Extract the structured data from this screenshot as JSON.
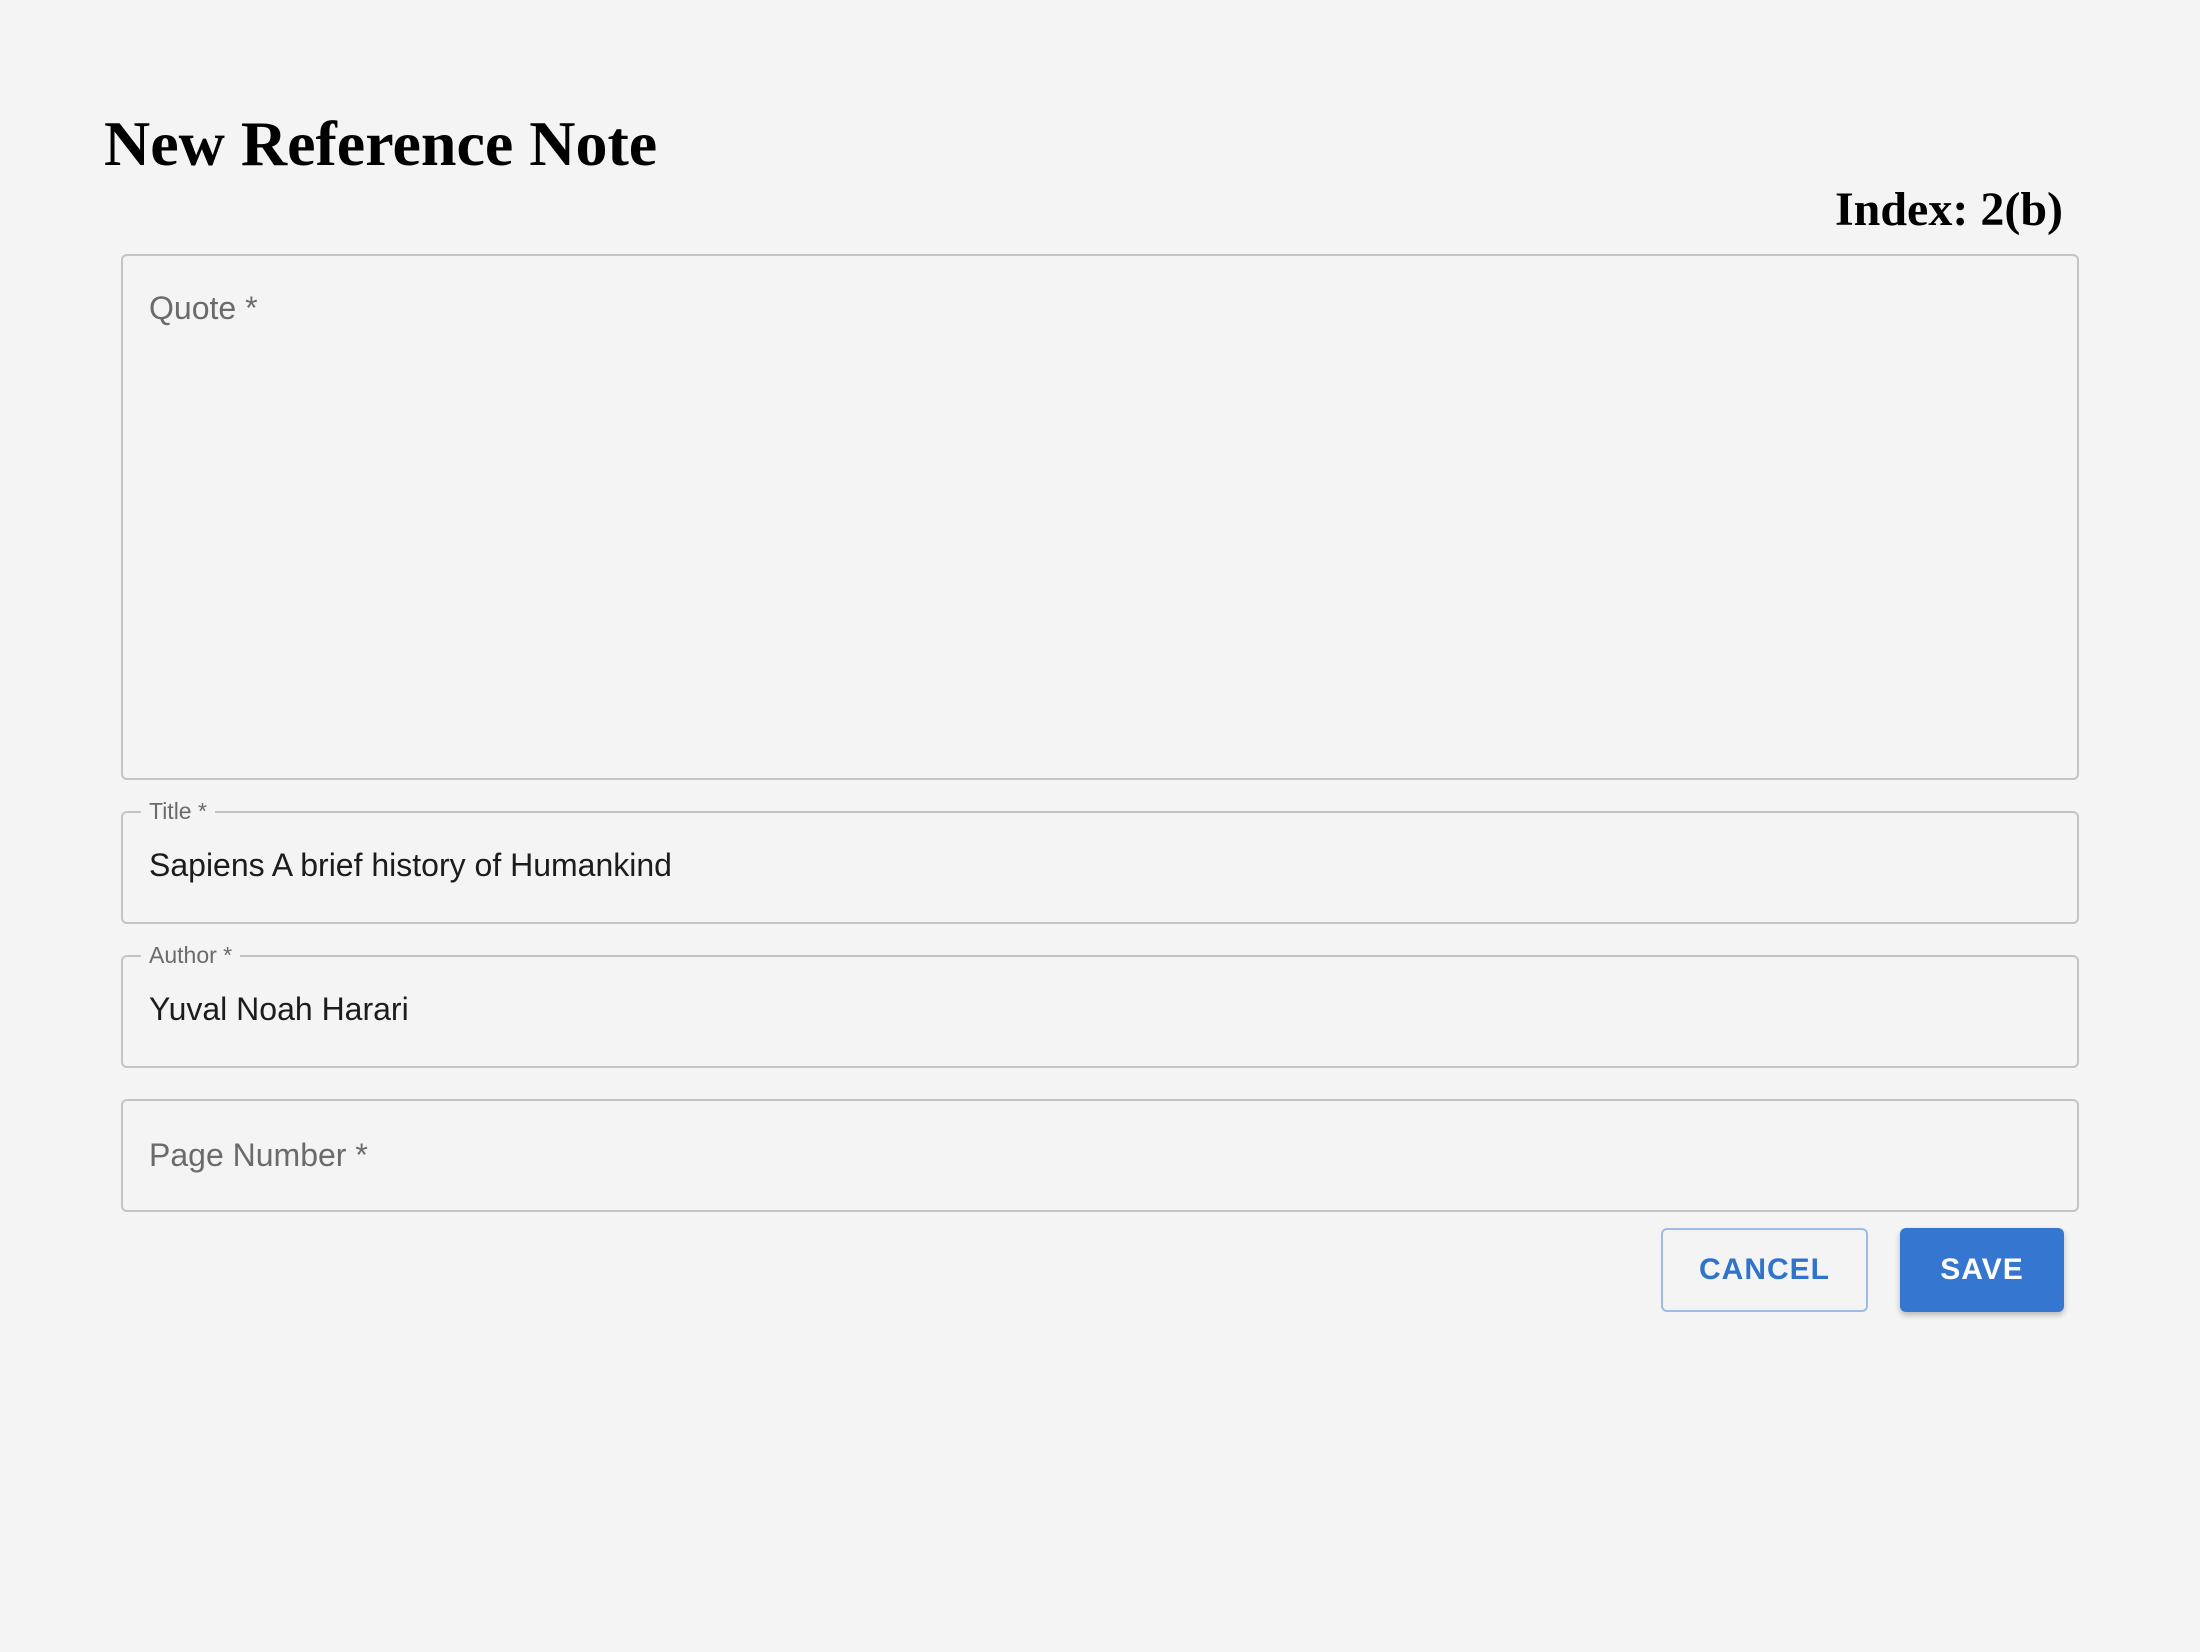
{
  "header": {
    "title": "New Reference Note",
    "index_label": "Index: 2(b)"
  },
  "form": {
    "quote": {
      "label": "Quote *",
      "value": ""
    },
    "title": {
      "label": "Title *",
      "value": "Sapiens A brief history of Humankind"
    },
    "author": {
      "label": "Author *",
      "value": "Yuval Noah Harari"
    },
    "page_number": {
      "label": "Page Number *",
      "value": ""
    }
  },
  "actions": {
    "cancel_label": "CANCEL",
    "save_label": "SAVE"
  },
  "colors": {
    "background": "#f4f4f4",
    "primary": "#3576d0",
    "field_border": "#c4c4c4",
    "label_gray": "#6b6b6b"
  }
}
